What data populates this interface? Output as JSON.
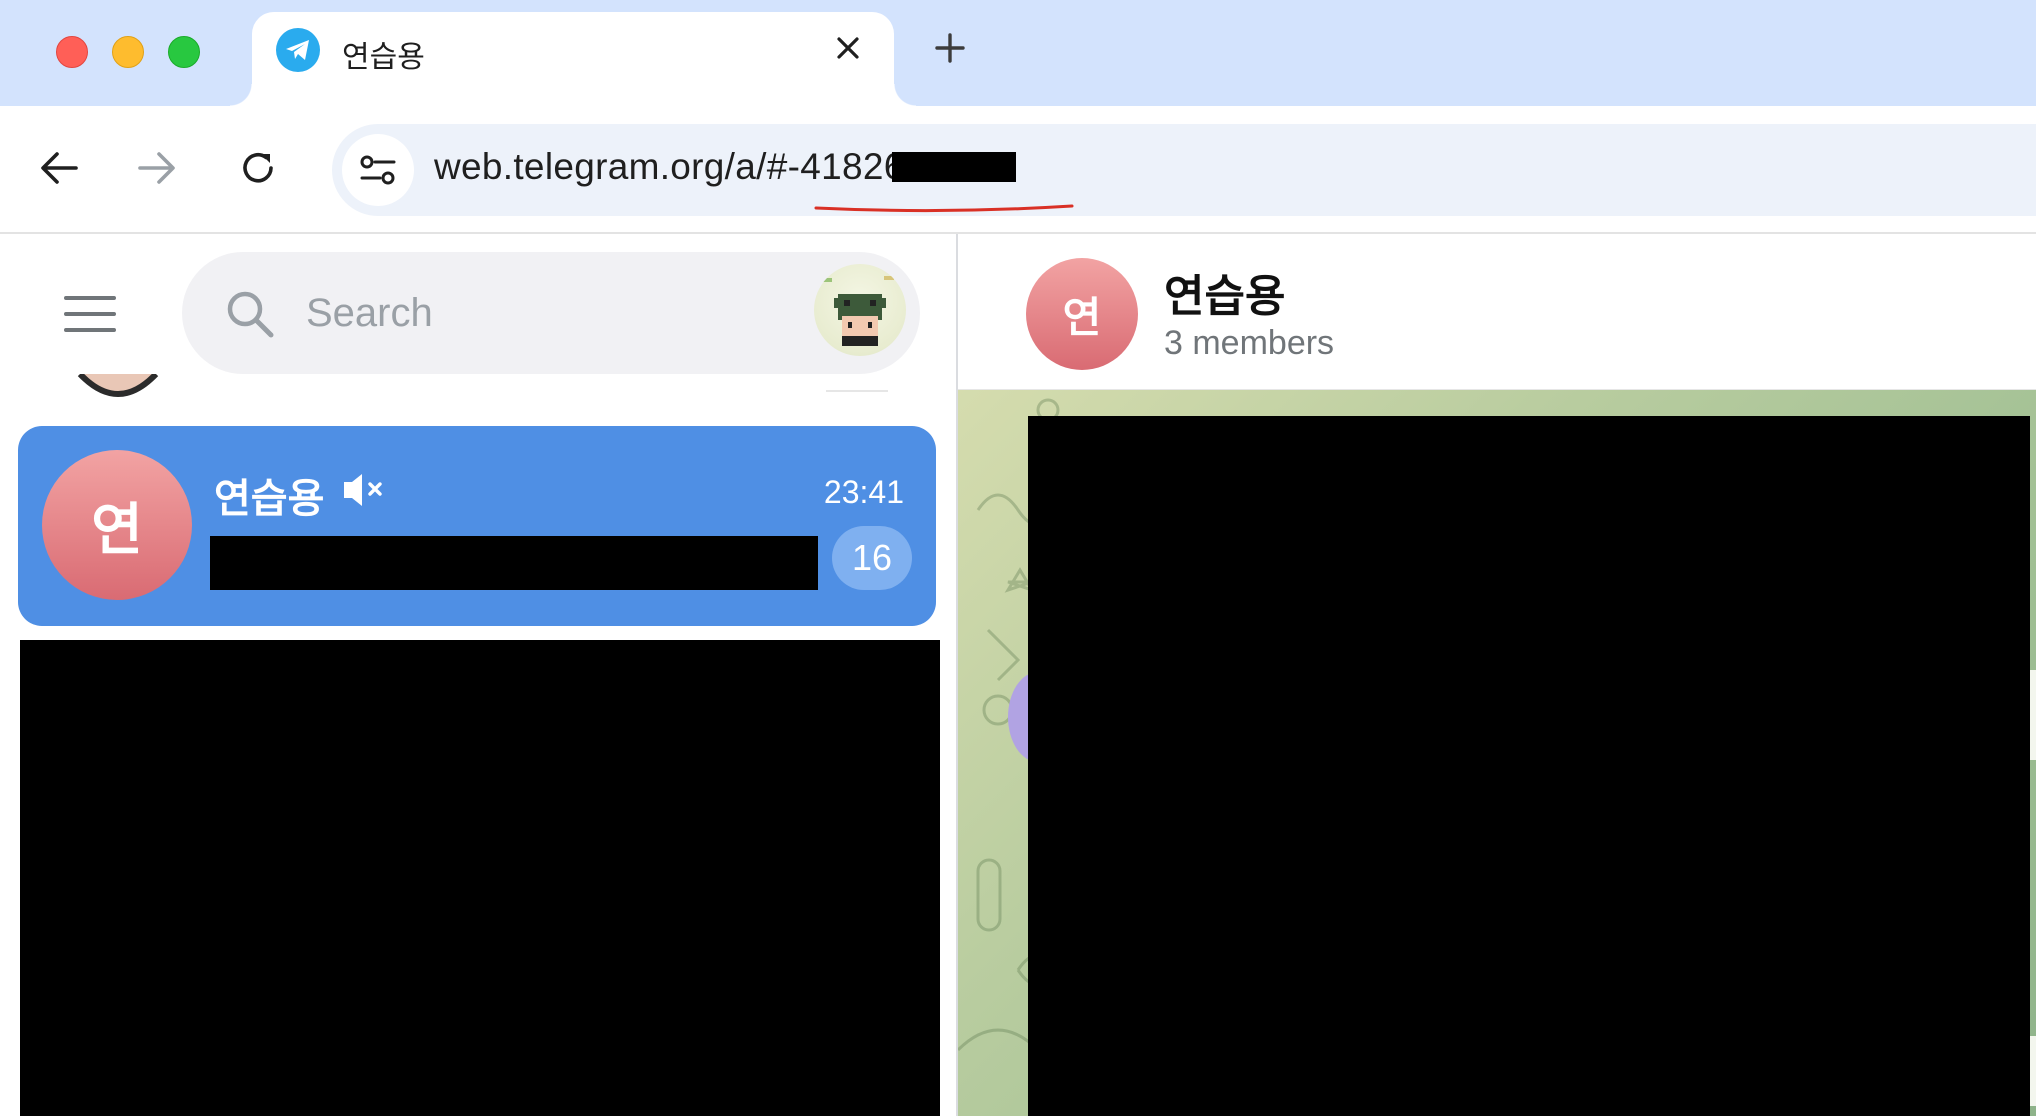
{
  "browser": {
    "tab": {
      "title": "연습용",
      "favicon": "telegram-icon",
      "close_icon": "close-icon"
    },
    "new_tab_icon": "plus-icon",
    "nav": {
      "back_icon": "arrow-left-icon",
      "forward_icon": "arrow-right-icon",
      "reload_icon": "reload-icon"
    },
    "omnibox": {
      "site_info_icon": "tune-icon",
      "url": "web.telegram.org/a/#-41826"
    }
  },
  "sidebar": {
    "menu_icon": "hamburger-menu-icon",
    "search": {
      "placeholder": "Search",
      "icon": "search-icon"
    },
    "chats": [
      {
        "avatar_letter": "연",
        "name": "연습용",
        "muted": true,
        "time": "23:41",
        "unread": "16",
        "selected": true
      }
    ]
  },
  "chat": {
    "header": {
      "avatar_letter": "연",
      "title": "연습용",
      "subtitle": "3 members"
    }
  },
  "colors": {
    "accent": "#4f8fe4",
    "tabstrip": "#d3e3fd",
    "avatar_gradient_top": "#f2a3a3",
    "avatar_gradient_bottom": "#d96b73",
    "url_annotation": "#d93025"
  }
}
